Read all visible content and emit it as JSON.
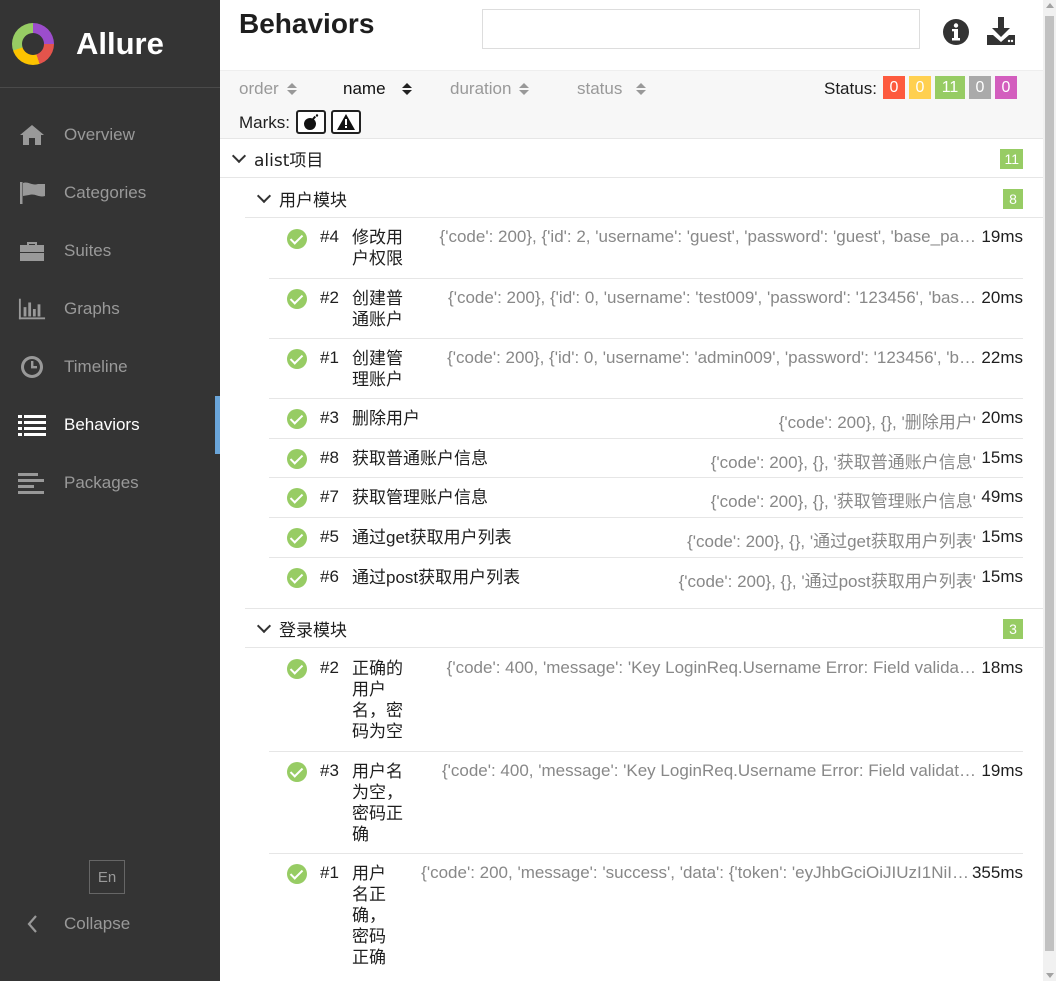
{
  "app": {
    "name": "Allure",
    "lang": "En",
    "collapse_label": "Collapse"
  },
  "sidebar": {
    "items": [
      {
        "label": "Overview",
        "icon": "home-icon"
      },
      {
        "label": "Categories",
        "icon": "flag-icon"
      },
      {
        "label": "Suites",
        "icon": "briefcase-icon"
      },
      {
        "label": "Graphs",
        "icon": "bar-chart-icon"
      },
      {
        "label": "Timeline",
        "icon": "clock-icon"
      },
      {
        "label": "Behaviors",
        "icon": "list-icon",
        "active": true
      },
      {
        "label": "Packages",
        "icon": "align-left-icon"
      }
    ]
  },
  "header": {
    "title": "Behaviors",
    "search_placeholder": ""
  },
  "toolbar": {
    "sort": [
      "order",
      "name",
      "duration",
      "status"
    ],
    "active_sort": "name",
    "status_label": "Status:",
    "status_counts": [
      {
        "value": "0",
        "color": "#fd5a3e"
      },
      {
        "value": "0",
        "color": "#ffd050"
      },
      {
        "value": "11",
        "color": "#97cc64"
      },
      {
        "value": "0",
        "color": "#aaaaaa"
      },
      {
        "value": "0",
        "color": "#d35ebe"
      }
    ],
    "marks_label": "Marks:"
  },
  "tree": {
    "root": {
      "name": "alist项目",
      "count": "11"
    },
    "groups": [
      {
        "name": "用户模块",
        "count": "8",
        "tests": [
          {
            "num": "#4",
            "name": "修改用户权限",
            "params": "{'code': 200}, {'id': 2, 'username': 'guest', 'password': 'guest', 'base_pa…",
            "duration": "19ms"
          },
          {
            "num": "#2",
            "name": "创建普通账户",
            "params": "{'code': 200}, {'id': 0, 'username': 'test009', 'password': '123456', 'bas…",
            "duration": "20ms"
          },
          {
            "num": "#1",
            "name": "创建管理账户",
            "params": "{'code': 200}, {'id': 0, 'username': 'admin009', 'password': '123456', 'b…",
            "duration": "22ms"
          },
          {
            "num": "#3",
            "name": "删除用户",
            "params": "{'code': 200}, {}, '删除用户'",
            "duration": "20ms"
          },
          {
            "num": "#8",
            "name": "获取普通账户信息",
            "params": "{'code': 200}, {}, '获取普通账户信息'",
            "duration": "15ms"
          },
          {
            "num": "#7",
            "name": "获取管理账户信息",
            "params": "{'code': 200}, {}, '获取管理账户信息'",
            "duration": "49ms"
          },
          {
            "num": "#5",
            "name": "通过get获取用户列表",
            "params": "{'code': 200}, {}, '通过get获取用户列表'",
            "duration": "15ms"
          },
          {
            "num": "#6",
            "name": "通过post获取用户列表",
            "params": "{'code': 200}, {}, '通过post获取用户列表'",
            "duration": "15ms"
          }
        ]
      },
      {
        "name": "登录模块",
        "count": "3",
        "tests": [
          {
            "num": "#2",
            "name": "正确的用户名，密码为空",
            "params": "{'code': 400, 'message': 'Key LoginReq.Username Error: Field valida…",
            "duration": "18ms"
          },
          {
            "num": "#3",
            "name": "用户名为空，密码正确",
            "params": "{'code': 400, 'message': 'Key LoginReq.Username Error: Field validat…",
            "duration": "19ms"
          },
          {
            "num": "#1",
            "name": "用户名正确，密码正确",
            "params": "{'code': 200, 'message': 'success', 'data': {'token': 'eyJhbGciOiJIUzI1NiI…",
            "duration": "355ms"
          }
        ]
      }
    ]
  }
}
